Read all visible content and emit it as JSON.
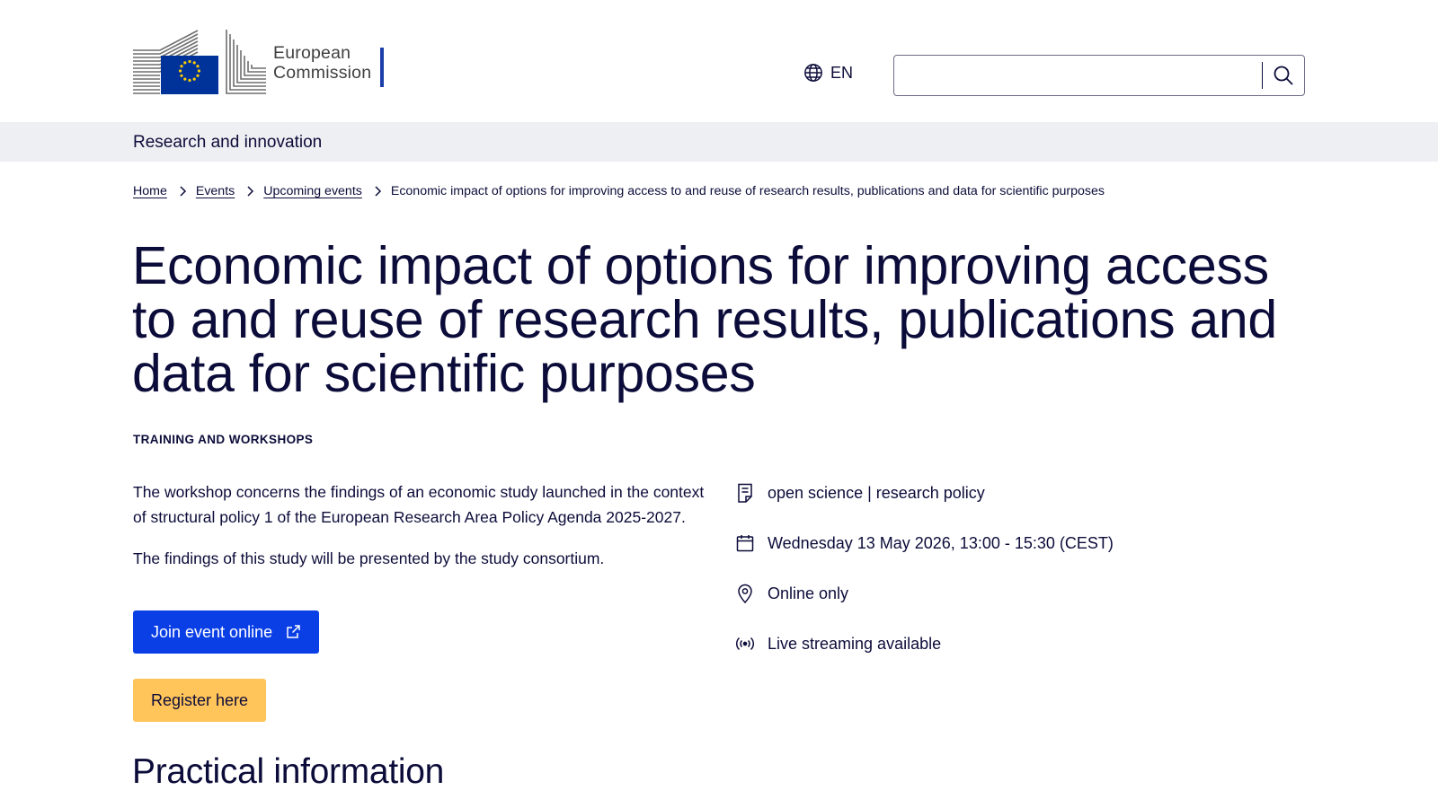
{
  "header": {
    "logo_line1": "European",
    "logo_line2": "Commission",
    "language": "EN",
    "search_placeholder": ""
  },
  "site": {
    "title": "Research and innovation"
  },
  "breadcrumb": {
    "items": [
      "Home",
      "Events",
      "Upcoming events"
    ],
    "current": "Economic impact of options for improving access to and reuse of research results, publications and data for scientific purposes"
  },
  "page": {
    "title": "Economic impact of options for improving access to and reuse of research results, publications and data for scientific purposes",
    "type": "TRAINING AND WORKSHOPS",
    "description": [
      "The workshop concerns the findings of an economic study launched in the context of structural policy 1 of the European Research Area Policy Agenda 2025-2027.",
      "The findings of this study will be presented by the study consortium."
    ],
    "join_label": "Join event online",
    "register_label": "Register here",
    "section_title": "Practical information"
  },
  "info": {
    "topics": "open science | research policy",
    "date": "Wednesday 13 May 2026, 13:00 - 15:30 (CEST)",
    "location": "Online only",
    "streaming": "Live streaming available"
  },
  "colors": {
    "primary_button": "#0a3fe6",
    "secondary_button": "#ffc45a",
    "text": "#0c0c3a",
    "site_bar": "#eeeff2",
    "eu_blue": "#003399",
    "eu_gold": "#ffcc00"
  },
  "icons": [
    "globe-icon",
    "search-icon",
    "chevron-right-icon",
    "external-link-icon",
    "document-icon",
    "calendar-icon",
    "location-pin-icon",
    "livestream-icon"
  ]
}
